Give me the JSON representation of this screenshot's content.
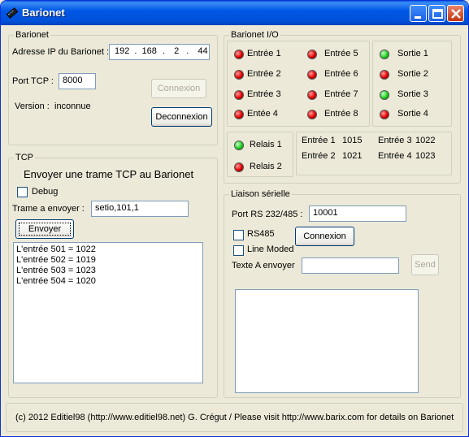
{
  "window": {
    "title": "Barionet"
  },
  "barionet_group": {
    "title": "Barionet",
    "ip_label": "Adresse IP du Barionet :",
    "ip": [
      "192",
      "168",
      "2",
      "44"
    ],
    "port_label": "Port TCP :",
    "port_value": "8000",
    "version_label": "Version :",
    "version_value": "inconnue",
    "connect_label": "Connexion",
    "disconnect_label": "Deconnexion"
  },
  "io_group": {
    "title": "Barionet I/O",
    "inputs": [
      {
        "label": "Entrée 1",
        "state": "red"
      },
      {
        "label": "Entrée 2",
        "state": "red"
      },
      {
        "label": "Entrée 3",
        "state": "red"
      },
      {
        "label": "Entée 4",
        "state": "red"
      },
      {
        "label": "Entrée 5",
        "state": "red"
      },
      {
        "label": "Entrée 6",
        "state": "red"
      },
      {
        "label": "Entrée 7",
        "state": "red"
      },
      {
        "label": "Entrée 8",
        "state": "red"
      }
    ],
    "outputs": [
      {
        "label": "Sortie 1",
        "state": "green"
      },
      {
        "label": "Sortie 2",
        "state": "red"
      },
      {
        "label": "Sortie 3",
        "state": "green"
      },
      {
        "label": "Sortie 4",
        "state": "red"
      }
    ],
    "relays": [
      {
        "label": "Relais 1",
        "state": "green"
      },
      {
        "label": "Relais 2",
        "state": "red"
      }
    ],
    "analog": [
      {
        "label": "Entrée 1",
        "value": "1015"
      },
      {
        "label": "Entrée 2",
        "value": "1021"
      },
      {
        "label": "Entrée 3",
        "value": "1022"
      },
      {
        "label": "Entrée 4",
        "value": "1023"
      }
    ]
  },
  "tcp_group": {
    "title": "TCP",
    "heading": "Envoyer une trame TCP au Barionet",
    "debug_label": "Debug",
    "frame_label": "Trame a envoyer :",
    "frame_value": "setio,101,1",
    "send_label": "Envoyer",
    "log": [
      "L'entrée 501 = 1022",
      "L'entrée 502 = 1019",
      "L'entrée 503 = 1023",
      "L'entrée 504 = 1020"
    ]
  },
  "serial_group": {
    "title": "Liaison sérielle",
    "port_label": "Port  RS 232/485 :",
    "port_value": "10001",
    "rs485_label": "RS485",
    "linemode_label": "Line Moded",
    "connect_label": "Connexion",
    "text_label": "Texte A envoyer",
    "text_value": "",
    "send_label": "Send"
  },
  "footer": {
    "text": "(c) 2012 Editiel98 (http://www.editiel98.net) G. Crégut   /  Please visit  http://www.barix.com for details on Barionet"
  },
  "colors": {
    "led_red": "#E00000",
    "led_green": "#1ED01E",
    "titlebar": "#0058E6"
  },
  "icons": {
    "app": "barionet-device-icon",
    "minimize": "minimize-icon",
    "maximize": "maximize-icon",
    "close": "close-icon"
  }
}
